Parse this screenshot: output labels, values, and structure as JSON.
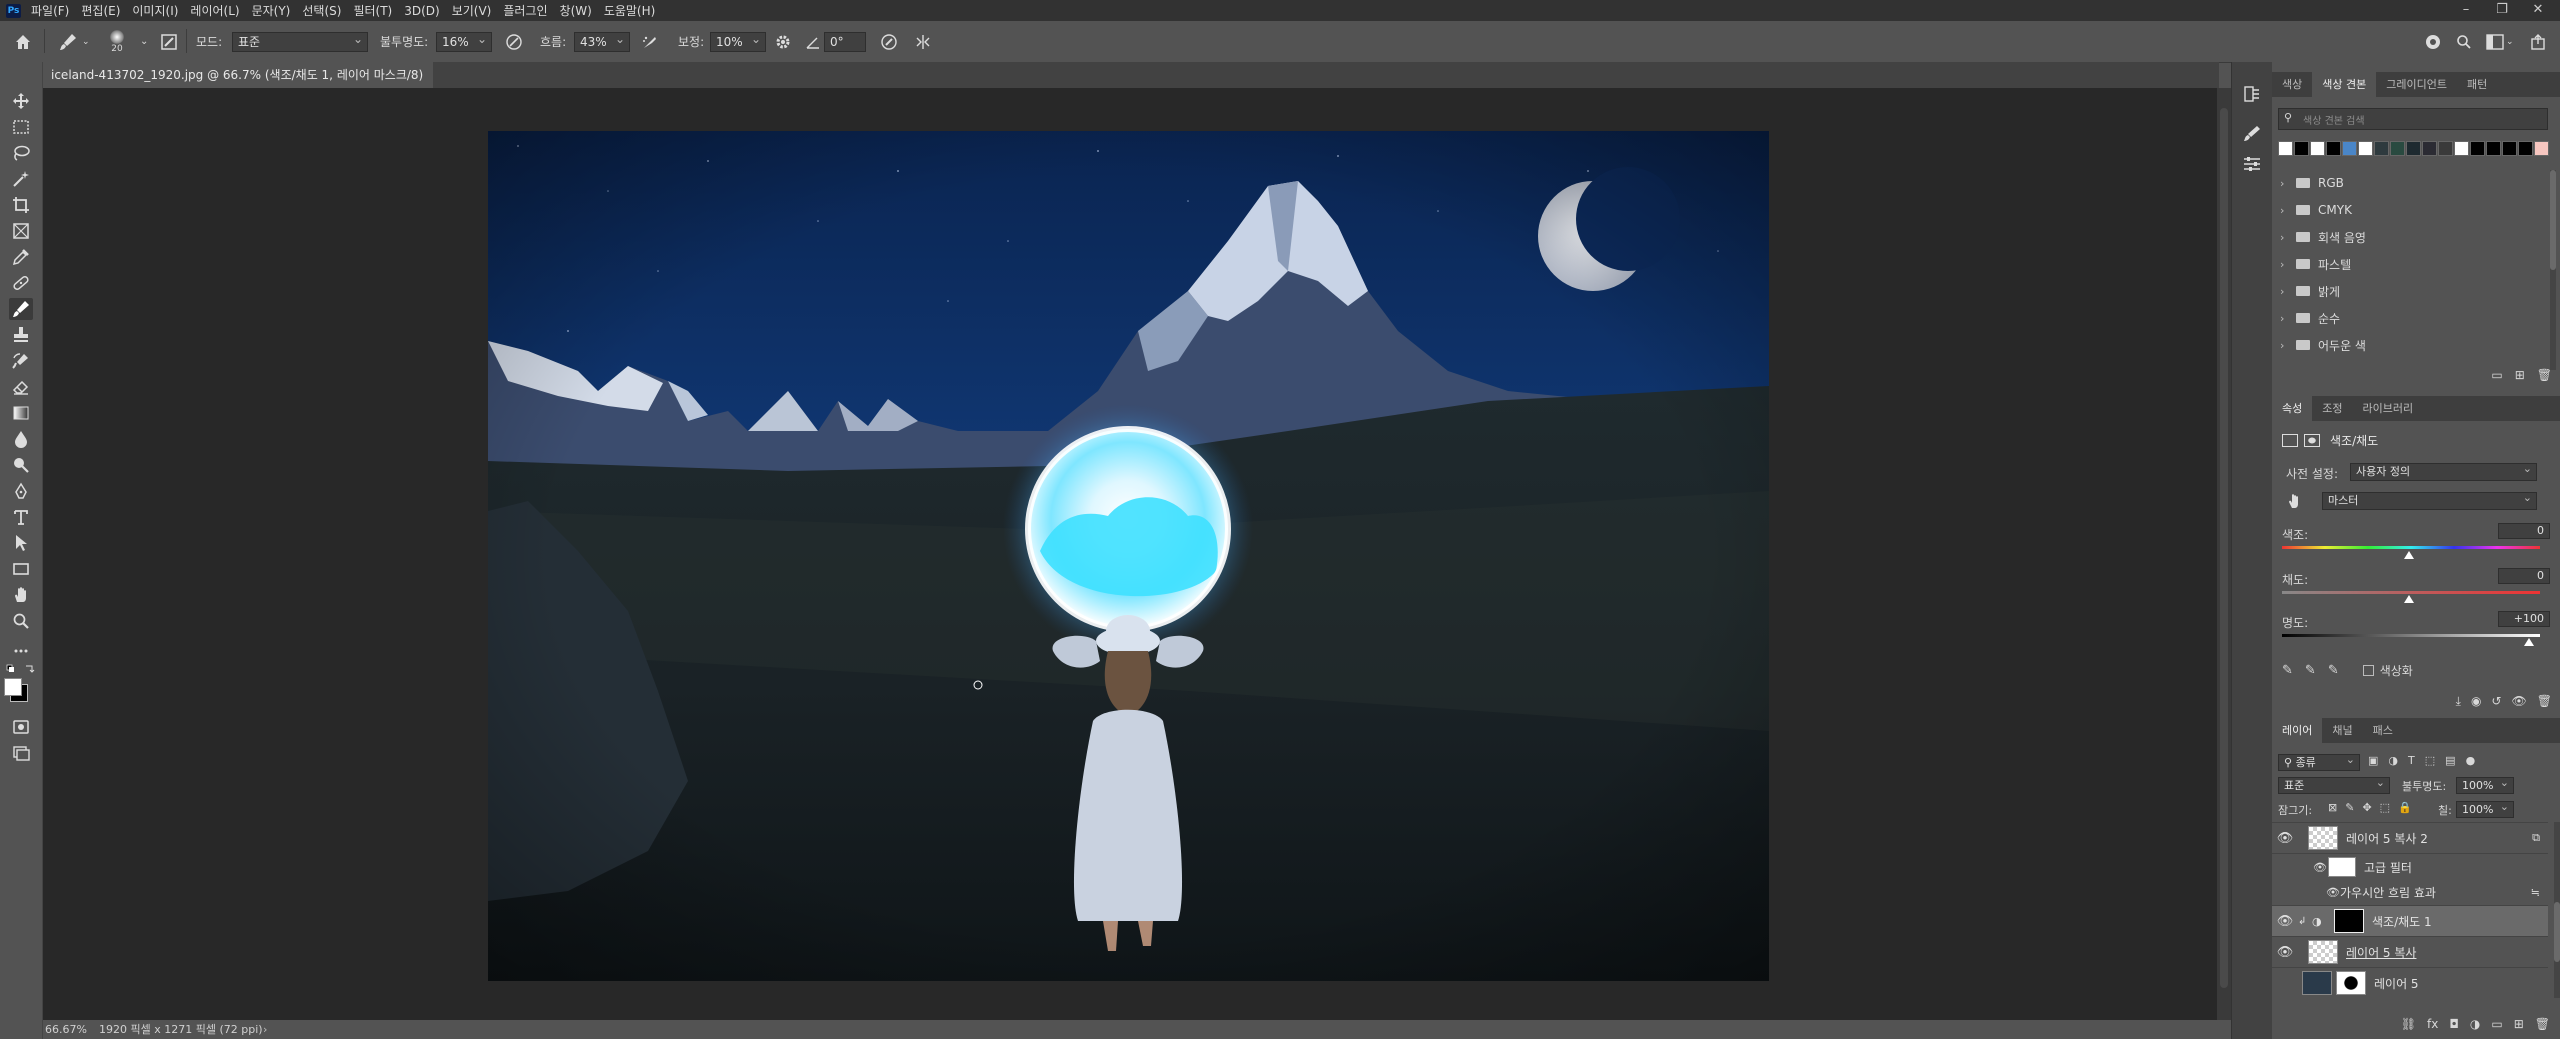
{
  "menu": [
    "파일(F)",
    "편집(E)",
    "이미지(I)",
    "레이어(L)",
    "문자(Y)",
    "선택(S)",
    "필터(T)",
    "3D(D)",
    "보기(V)",
    "플러그인",
    "창(W)",
    "도움말(H)"
  ],
  "options": {
    "brush_size": "20",
    "mode_label": "모드:",
    "mode_value": "표준",
    "opacity_label": "불투명도:",
    "opacity_value": "16%",
    "flow_label": "흐름:",
    "flow_value": "43%",
    "smoothing_label": "보정:",
    "smoothing_value": "10%",
    "angle_value": "0°"
  },
  "document": {
    "tab_title": "iceland-413702_1920.jpg @ 66.7% (색조/채도 1, 레이어 마스크/8) *",
    "close": "×"
  },
  "status": {
    "zoom": "66.67%",
    "info": "1920 픽셀 x 1271 픽셀 (72 ppi)",
    "arrow": "›"
  },
  "swatches_panel": {
    "tabs": [
      "색상",
      "색상 견본",
      "그레이디언트",
      "패턴"
    ],
    "active_tab": 1,
    "search_placeholder": "색상 견본 검색",
    "colors": [
      "#ffffff",
      "#000000",
      "#ffffff",
      "#000000",
      "#4a86c8",
      "#ffffff",
      "#2e3a3e",
      "#294a40",
      "#1e2a30",
      "#2b2b33",
      "#3a3a3a",
      "#ffffff",
      "#000000",
      "#000000",
      "#000000",
      "#000000",
      "#f6c6c0"
    ],
    "folders": [
      "RGB",
      "CMYK",
      "회색 음영",
      "파스텔",
      "밝게",
      "순수",
      "어두운 색"
    ]
  },
  "properties_panel": {
    "tabs": [
      "속성",
      "조정",
      "라이브러리"
    ],
    "title": "색조/채도",
    "preset_label": "사전 설정:",
    "preset_value": "사용자 정의",
    "channel_value": "마스터",
    "hue_label": "색조:",
    "hue_value": "0",
    "saturation_label": "채도:",
    "saturation_value": "0",
    "lightness_label": "명도:",
    "lightness_value": "+100",
    "colorize_label": "색상화"
  },
  "layers_panel": {
    "tabs": [
      "레이어",
      "채널",
      "패스"
    ],
    "filter_value": "종류",
    "blend_mode": "표준",
    "opacity_label": "불투명도:",
    "opacity_value": "100%",
    "lock_label": "잠그기:",
    "fill_label": "칠:",
    "fill_value": "100%",
    "layers": [
      {
        "name": "레이어 5 복사 2",
        "visible": true
      },
      {
        "name": "고급 필터",
        "visible": true
      },
      {
        "name": "가우시안 흐림 효과",
        "visible": true
      },
      {
        "name": "색조/채도 1",
        "visible": true
      },
      {
        "name": "레이어 5 복사",
        "visible": true
      },
      {
        "name": "레이어 5",
        "visible": false
      }
    ]
  },
  "colors": {
    "menubar": "#323232",
    "ui": "#535353",
    "canvas": "#282828",
    "selected_layer": "#6a6a6a"
  }
}
